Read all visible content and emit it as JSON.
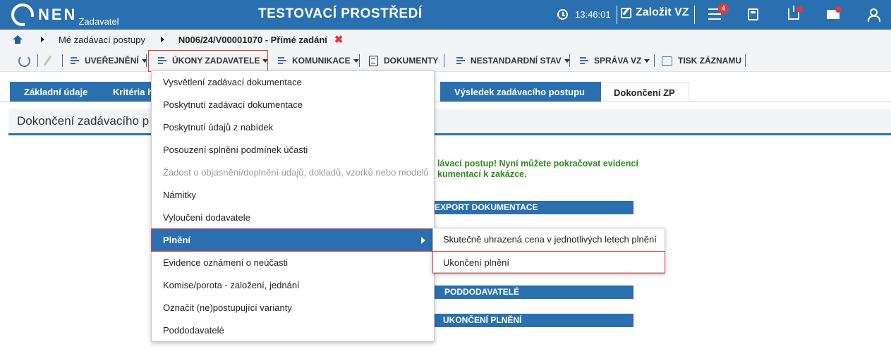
{
  "header": {
    "logo_text": "NEN",
    "logo_sub": "Zadavatel",
    "env_title": "TESTOVACÍ PROSTŘEDÍ",
    "time": "13:46:01",
    "create_label": "Založit VZ",
    "notification_count": "4",
    "accent_color": "#2a70b0"
  },
  "breadcrumb": {
    "item1": "Mé zadávací postupy",
    "current": "N006/24/V00001070 - Přímé zadání",
    "close_symbol": "✖"
  },
  "toolbar": {
    "publish": "UVEŘEJNĚNÍ",
    "actions": "ÚKONY ZADAVATELE",
    "communication": "KOMUNIKACE",
    "documents": "DOKUMENTY",
    "nonstandard": "NESTANDARDNÍ STAV",
    "management": "SPRÁVA VZ",
    "print": "TISK ZÁZNAMU"
  },
  "tabs": [
    {
      "label": "Základní údaje"
    },
    {
      "label": "Kritéria h"
    },
    {
      "label": "Výsledek zadávacího postupu"
    },
    {
      "label": "Dokončení ZP"
    }
  ],
  "page": {
    "heading": "Dokončení zadávacího p",
    "success_line1": "lávací postup! Nyní můžete pokračovat evidencí",
    "success_line2": "kumentací k zakázce.",
    "sections": [
      "EXPORT DOKUMENTACE",
      "PODDODAVATELÉ",
      "UKONČENÍ PLNĚNÍ"
    ]
  },
  "dropdown": {
    "items": [
      "Vysvětlení zadávací dokumentace",
      "Poskytnutí zadávací dokumentace",
      "Poskytnutí údajů z nabídek",
      "Posouzení splnění podmínek účasti",
      "Žádost o objasnění/doplnění údajů, dokladů, vzorků nebo modelů",
      "Námitky",
      "Vyloučení dodavatele",
      "Plnění",
      "Evidence oznámení o neúčasti",
      "Komise/porota - založení, jednání",
      "Označit (ne)postupující varianty",
      "Poddodavatelé"
    ]
  },
  "submenu": {
    "items": [
      "Skutečně uhrazená cena v jednotlivých letech plnění",
      "Ukončení plnění"
    ]
  }
}
